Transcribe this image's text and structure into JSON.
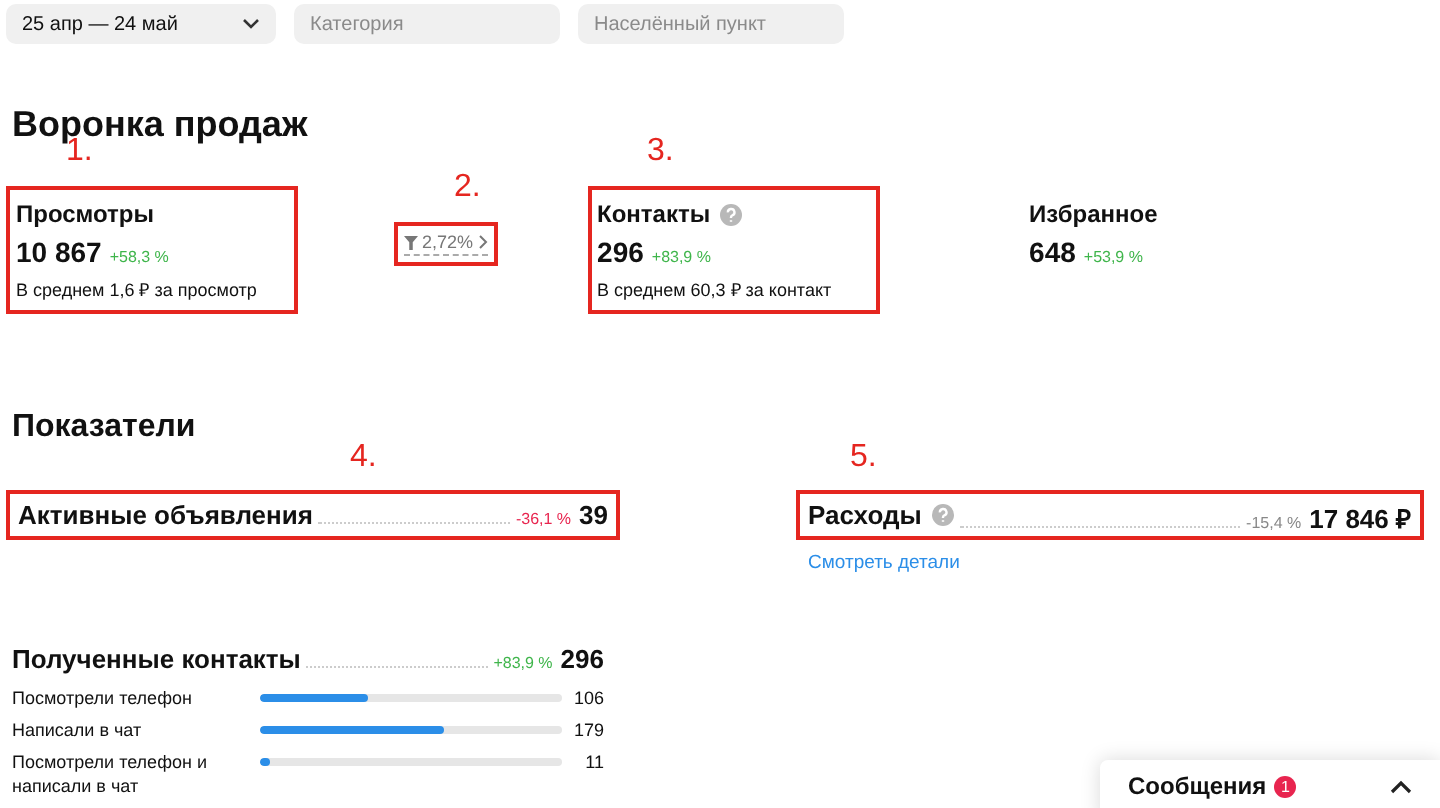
{
  "filters": [
    {
      "kind": "dropdown",
      "value": "25 апр — 24 май"
    },
    {
      "kind": "input",
      "placeholder": "Категория"
    },
    {
      "kind": "input",
      "placeholder": "Населённый пункт"
    }
  ],
  "funnel": {
    "title": "Воронка продаж",
    "items": [
      {
        "kind": "stat",
        "title": "Просмотры",
        "help": false,
        "value": "10 867",
        "change": "+58,3 %",
        "color": "#3fb54b",
        "note": "В среднем 1,6 ₽ за просмотр",
        "annotation": "1."
      },
      {
        "kind": "conversion",
        "value": "2,72%",
        "annotation": "2."
      },
      {
        "kind": "stat",
        "title": "Контакты",
        "help": true,
        "value": "296",
        "change": "+83,9 %",
        "color": "#3fb54b",
        "note": "В среднем 60,3 ₽ за контакт",
        "annotation": "3."
      },
      {
        "kind": "stat",
        "title": "Избранное",
        "help": false,
        "value": "648",
        "change": "+53,9 %",
        "color": "#3fb54b"
      }
    ]
  },
  "metrics": {
    "title": "Показатели",
    "items": [
      {
        "label": "Активные объявления",
        "help": false,
        "change": "-36,1 %",
        "color": "#e8254f",
        "value": "39",
        "annotation": "4."
      },
      {
        "label": "Расходы",
        "help": true,
        "change": "-15,4 %",
        "color": "#888888",
        "value": "17 846 ₽",
        "annotation": "5.",
        "link": "Смотреть детали"
      }
    ]
  },
  "contacts": {
    "title": "Полученные контакты",
    "change": "+83,9 %",
    "color": "#3fb54b",
    "value": "296",
    "rows": [
      {
        "label": "Посмотрели телефон",
        "level": 0.36,
        "value": "106"
      },
      {
        "label": "Написали в чат",
        "level": 0.61,
        "value": "179"
      },
      {
        "label": "Посмотрели телефон и написали в чат",
        "level": 0.03,
        "value": "11"
      }
    ]
  },
  "messages": {
    "title": "Сообщения",
    "badge": "1"
  }
}
